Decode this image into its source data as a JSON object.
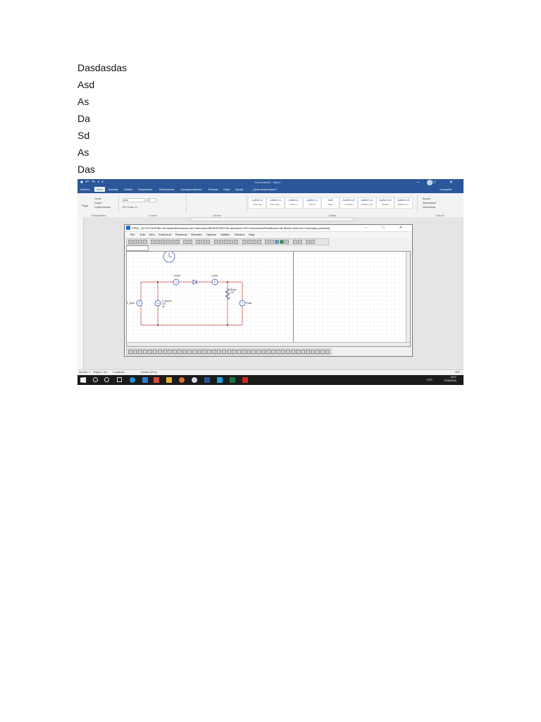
{
  "document_lines": [
    "Dasdasdas",
    "Asd",
    "As",
    "Da",
    "Sd",
    "As",
    "Das"
  ],
  "screenshot": {
    "word": {
      "quick_access": "■ ↶ ↷ • •",
      "title": "Documento1 - Word",
      "window_controls": "– □ ✕",
      "tabs": [
        "Archivo",
        "Inicio",
        "Insertar",
        "Diseño",
        "Disposición",
        "Referencias",
        "Correspondencia",
        "Revisar",
        "Vista",
        "Ayuda"
      ],
      "tell_me": "¿Qué desea hacer?",
      "share": "Compartir",
      "ribbon": {
        "clipboard": {
          "paste": "Pegar",
          "cut": "Cortar",
          "copy": "Copiar",
          "format": "Copiar formato",
          "label": "Portapapeles"
        },
        "font": {
          "name": "Arial",
          "size": "12",
          "label": "Fuente"
        },
        "paragraph": {
          "label": "Párrafo"
        },
        "styles": {
          "label": "Estilos",
          "items": [
            {
              "sample": "AaBbCcI",
              "name": "¶ Normal"
            },
            {
              "sample": "AaBbCcI",
              "name": "¶ Sin espa..."
            },
            {
              "sample": "AaBbCc",
              "name": "Título 1"
            },
            {
              "sample": "AaBbCcI",
              "name": "Título 2"
            },
            {
              "sample": "AaB",
              "name": "Título"
            },
            {
              "sample": "AaBbCcD",
              "name": "Subtítulo"
            },
            {
              "sample": "AaBbCcD",
              "name": "Énfasis sutil"
            },
            {
              "sample": "AaBbCcD",
              "name": "Énfasis"
            },
            {
              "sample": "AaBbCcD",
              "name": "Énfasis int..."
            }
          ]
        },
        "editing": {
          "find": "Buscar",
          "replace": "Reemplazar",
          "select": "Seleccionar",
          "label": "Edición"
        }
      },
      "status": {
        "section": "Sección: 1",
        "page": "Página 1 de 1",
        "words": "0 palabras",
        "language": "Español (Perú)",
        "zoom": "90%"
      }
    },
    "psim": {
      "title": "PSIM - [D:\\TECSUP\\5to Semestre\\Electronica de Potencia\\LABORATORIOS\\Laboratorio Nº11 Armónicos\\Rectificador de Media Onda No Controlado.psimsch]",
      "window_controls": "– □ ✕",
      "menu": [
        "File",
        "Edit",
        "View",
        "Subcircuit",
        "Elements",
        "Simulate",
        "Options",
        "Utilities",
        "Window",
        "Help"
      ],
      "labels": {
        "i_input": "I_input",
        "i_load": "I_load",
        "r_load": "Rload",
        "r_load_value": "270",
        "p_input": "P_input",
        "v_source": "V_source",
        "v_source_value1": "170",
        "v_source_value2": "60",
        "p_load": "Pload",
        "ammeter": "A",
        "wattmeter": "P"
      }
    },
    "taskbar": {
      "language": "ESP",
      "time": "15:57",
      "date": "27/06/2020"
    }
  },
  "colors": {
    "word_blue": "#2b579a",
    "circuit_red": "#d23b3b",
    "circuit_blue": "#2a3fa6"
  }
}
